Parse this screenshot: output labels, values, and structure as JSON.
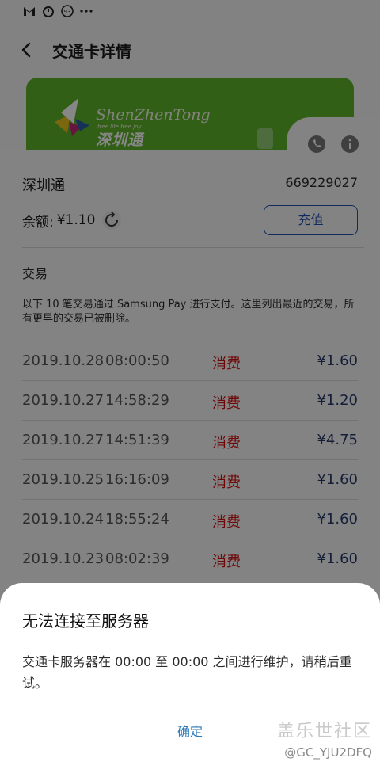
{
  "header": {
    "title": "交通卡详情"
  },
  "card": {
    "brand_en": "ShenZhenTong",
    "brand_tagline": "free life free joy",
    "brand_cn": "深圳通",
    "name": "深圳通",
    "number": "669229027",
    "balance_label": "余额:",
    "balance_value": "¥1.10",
    "topup_label": "充值"
  },
  "transactions": {
    "title": "交易",
    "note": "以下 10 笔交易通过 Samsung Pay 进行支付。这里列出最近的交易，所有更早的交易已被删除。",
    "rows": [
      {
        "date": "2019.10.28",
        "time": "08:00:50",
        "type": "消费",
        "amount": "¥1.60"
      },
      {
        "date": "2019.10.27",
        "time": "14:58:29",
        "type": "消费",
        "amount": "¥1.20"
      },
      {
        "date": "2019.10.27",
        "time": "14:51:39",
        "type": "消费",
        "amount": "¥4.75"
      },
      {
        "date": "2019.10.25",
        "time": "16:16:09",
        "type": "消费",
        "amount": "¥1.60"
      },
      {
        "date": "2019.10.24",
        "time": "18:55:24",
        "type": "消费",
        "amount": "¥1.60"
      },
      {
        "date": "2019.10.23",
        "time": "08:02:39",
        "type": "消费",
        "amount": "¥1.60"
      }
    ]
  },
  "dialog": {
    "title": "无法连接至服务器",
    "body": "交通卡服务器在 00:00 至 00:00 之间进行维护，请稍后重试。",
    "confirm_label": "确定"
  },
  "watermark": {
    "site": "盖乐世社区",
    "user": "@GC_YJU2DFQ"
  },
  "colors": {
    "card_green": "#5fb32b",
    "accent_blue": "#1f4fb3",
    "expense_red": "#d01010",
    "confirm_blue": "#2d7ab8"
  }
}
